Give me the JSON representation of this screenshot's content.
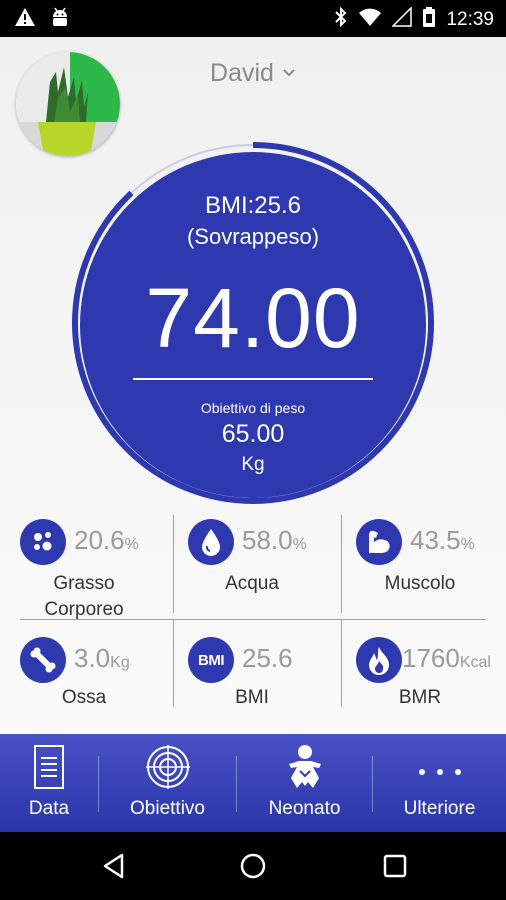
{
  "status_bar": {
    "time": "12:39"
  },
  "profile": {
    "user_name": "David"
  },
  "gauge": {
    "bmi": "BMI:25.6",
    "bmi_category": "(Sovrappeso)",
    "weight": "74.00",
    "goal_label": "Obiettivo di peso",
    "goal_value": "65.00",
    "goal_unit": "Kg",
    "progress_fraction": 0.88
  },
  "metrics": [
    {
      "value": "20.6",
      "unit": "%",
      "label": "Grasso Corporeo",
      "icon": "body-fat-icon"
    },
    {
      "value": "58.0",
      "unit": "%",
      "label": "Acqua",
      "icon": "water-drop-icon"
    },
    {
      "value": "43.5",
      "unit": "%",
      "label": "Muscolo",
      "icon": "muscle-icon"
    },
    {
      "value": "3.0",
      "unit": "Kg",
      "label": "Ossa",
      "icon": "bone-icon"
    },
    {
      "value": "25.6",
      "unit": "",
      "label": "BMI",
      "icon": "bmi-icon",
      "icon_text": "BMI"
    },
    {
      "value": "1760",
      "unit": "Kcal",
      "label": "BMR",
      "icon": "flame-icon"
    }
  ],
  "nav": [
    {
      "label": "Data",
      "icon": "data-icon"
    },
    {
      "label": "Obiettivo",
      "icon": "target-icon"
    },
    {
      "label": "Neonato",
      "icon": "baby-icon"
    },
    {
      "label": "Ulteriore",
      "icon": "more-icon"
    }
  ],
  "colors": {
    "primary": "#2e39b0",
    "nav_top": "#4851c4",
    "nav_bottom": "#2a36ab"
  }
}
